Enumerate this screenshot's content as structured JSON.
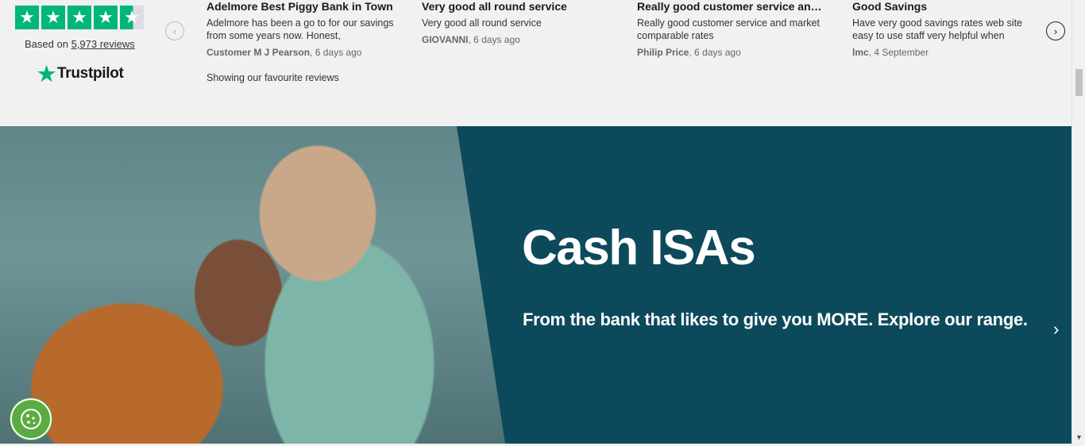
{
  "trustpilot": {
    "based_prefix": "Based on",
    "reviews_link": "5,973 reviews",
    "logo_text": "Trustpilot",
    "showing_text": "Showing our favourite reviews"
  },
  "reviews": [
    {
      "title": "Adelmore Best Piggy Bank in Town",
      "body": "Adelmore has been a go to for our savings from some years now. Honest,",
      "author": "Customer M J Pearson",
      "date": ", 6 days ago"
    },
    {
      "title": "Very good all round service",
      "body": "Very good all round service",
      "author": "GIOVANNI",
      "date": ", 6 days ago"
    },
    {
      "title": "Really good customer service an…",
      "body": "Really good customer service and market comparable rates",
      "author": "Philip Price",
      "date": ", 6 days ago"
    },
    {
      "title": "Good Savings",
      "body": "Have very good savings rates web site easy to use staff very helpful when",
      "author": "lmc",
      "date": ", 4 September"
    }
  ],
  "hero": {
    "title": "Cash ISAs",
    "subtitle": "From the bank that likes to give you MORE. Explore our range."
  },
  "icons": {
    "star": "star-icon",
    "prev": "chevron-left-icon",
    "next": "chevron-right-icon",
    "cookie": "cookie-icon"
  },
  "colors": {
    "trustpilot_green": "#00b67a",
    "hero_bg": "#0c4a5b",
    "cookie_green": "#5aac41"
  }
}
